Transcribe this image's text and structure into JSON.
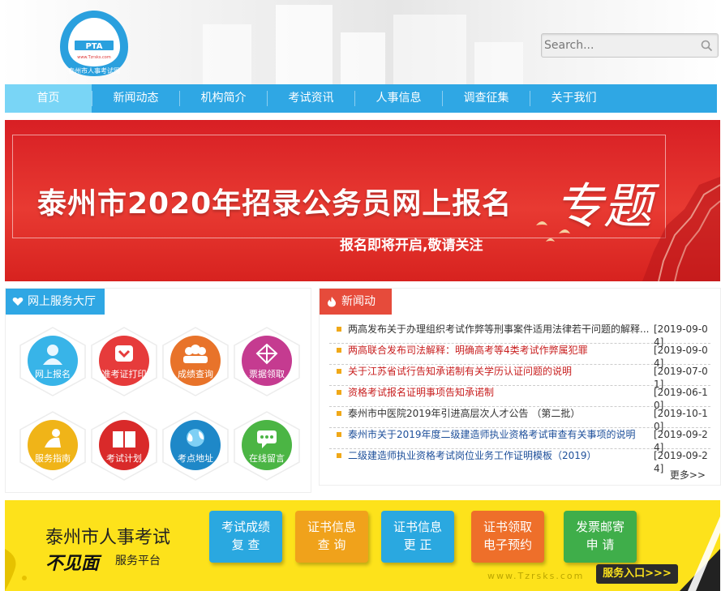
{
  "header": {
    "logo_text": "PTA",
    "logo_url": "www.Tzrsks.com",
    "logo_name": "泰州市人事考试网",
    "search_placeholder": "Search..."
  },
  "nav": {
    "items": [
      {
        "label": "首页",
        "active": true
      },
      {
        "label": "新闻动态"
      },
      {
        "label": "机构简介"
      },
      {
        "label": "考试资讯"
      },
      {
        "label": "人事信息"
      },
      {
        "label": "调查征集"
      },
      {
        "label": "关于我们"
      }
    ]
  },
  "banner": {
    "title": "泰州市2020年招录公务员网上报名",
    "special": "专题",
    "subtitle": "报名即将开启,敬请关注"
  },
  "services": {
    "heading": "网上服务大厅",
    "items": [
      {
        "label": "网上报名",
        "color": "#38b4e8"
      },
      {
        "label": "准考证打印",
        "color": "#e63b3b"
      },
      {
        "label": "成绩查询",
        "color": "#e8732a"
      },
      {
        "label": "票据领取",
        "color": "#c53b90"
      },
      {
        "label": "服务指南",
        "color": "#f0b418"
      },
      {
        "label": "考试计划",
        "color": "#d92a2a"
      },
      {
        "label": "考点地址",
        "color": "#1e88c8"
      },
      {
        "label": "在线留言",
        "color": "#4bb544"
      }
    ]
  },
  "news": {
    "heading": "新闻动态",
    "items": [
      {
        "title": "两高发布关于办理组织考试作弊等刑事案件适用法律若干问题的解释...",
        "date": "[2019-09-04]",
        "color": "normal"
      },
      {
        "title": "两高联合发布司法解释：明确高考等4类考试作弊属犯罪",
        "date": "[2019-09-04]",
        "color": "red"
      },
      {
        "title": "关于江苏省试行告知承诺制有关学历认证问题的说明",
        "date": "[2019-07-01]",
        "color": "red"
      },
      {
        "title": "资格考试报名证明事项告知承诺制",
        "date": "[2019-06-10]",
        "color": "red"
      },
      {
        "title": "泰州市中医院2019年引进高层次人才公告 （第二批）",
        "date": "[2019-10-10]",
        "color": "normal"
      },
      {
        "title": "泰州市关于2019年度二级建造师执业资格考试审查有关事项的说明",
        "date": "[2019-09-24]",
        "color": "blue"
      },
      {
        "title": "二级建造师执业资格考试岗位业务工作证明模板（2019）",
        "date": "[2019-09-24]",
        "color": "blue"
      }
    ],
    "more": "更多>>"
  },
  "promo": {
    "title": "泰州市人事考试",
    "big": "不见面",
    "small": "服务平台",
    "buttons": [
      {
        "line1": "考试成绩",
        "line2": "复 查",
        "color": "#2aa8e0"
      },
      {
        "line1": "证书信息",
        "line2": "查 询",
        "color": "#f0a21b"
      },
      {
        "line1": "证书信息",
        "line2": "更 正",
        "color": "#2aa8e0"
      },
      {
        "line1": "证书领取",
        "line2": "电子预约",
        "color": "#ee6f2a"
      },
      {
        "line1": "发票邮寄",
        "line2": "申 请",
        "color": "#3fae4a"
      }
    ],
    "url": "www.Tzrsks.com",
    "entry": "服务入口>>>"
  }
}
